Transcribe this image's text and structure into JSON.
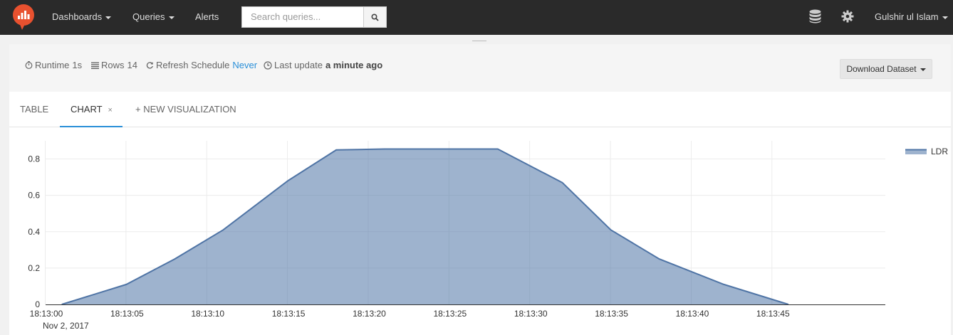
{
  "nav": {
    "dashboards": "Dashboards",
    "queries": "Queries",
    "alerts": "Alerts",
    "search_placeholder": "Search queries...",
    "user": "Gulshir ul Islam",
    "accent_color": "#e8512f"
  },
  "meta": {
    "runtime_label": "Runtime",
    "runtime_value": "1s",
    "rows_label": "Rows",
    "rows_value": "14",
    "refresh_label": "Refresh Schedule",
    "refresh_value": "Never",
    "update_label": "Last update",
    "update_value": "a minute ago",
    "download_label": "Download Dataset"
  },
  "tabs": [
    {
      "label": "Table"
    },
    {
      "label": "Chart",
      "close": "×"
    },
    {
      "label": "+ New Visualization"
    }
  ],
  "chart_data": {
    "type": "area",
    "x": [
      "18:13:01",
      "18:13:05",
      "18:13:08",
      "18:13:11",
      "18:13:15",
      "18:13:18",
      "18:13:21",
      "18:13:25",
      "18:13:28",
      "18:13:32",
      "18:13:35",
      "18:13:38",
      "18:13:42",
      "18:13:46"
    ],
    "series": [
      {
        "name": "LDR",
        "values": [
          0,
          0.11,
          0.25,
          0.41,
          0.68,
          0.85,
          0.855,
          0.855,
          0.855,
          0.67,
          0.41,
          0.25,
          0.11,
          0
        ],
        "color": "#4f74a5"
      }
    ],
    "x_ticks": [
      "18:13:00",
      "18:13:05",
      "18:13:10",
      "18:13:15",
      "18:13:20",
      "18:13:25",
      "18:13:30",
      "18:13:35",
      "18:13:40",
      "18:13:45"
    ],
    "x_tick_date": "Nov 2, 2017",
    "y_ticks": [
      "0",
      "0.2",
      "0.4",
      "0.6",
      "0.8"
    ],
    "ylim": [
      0,
      0.9
    ],
    "xlim": [
      "18:13:00",
      "18:13:52"
    ],
    "grid": true,
    "legend": "top-right"
  }
}
